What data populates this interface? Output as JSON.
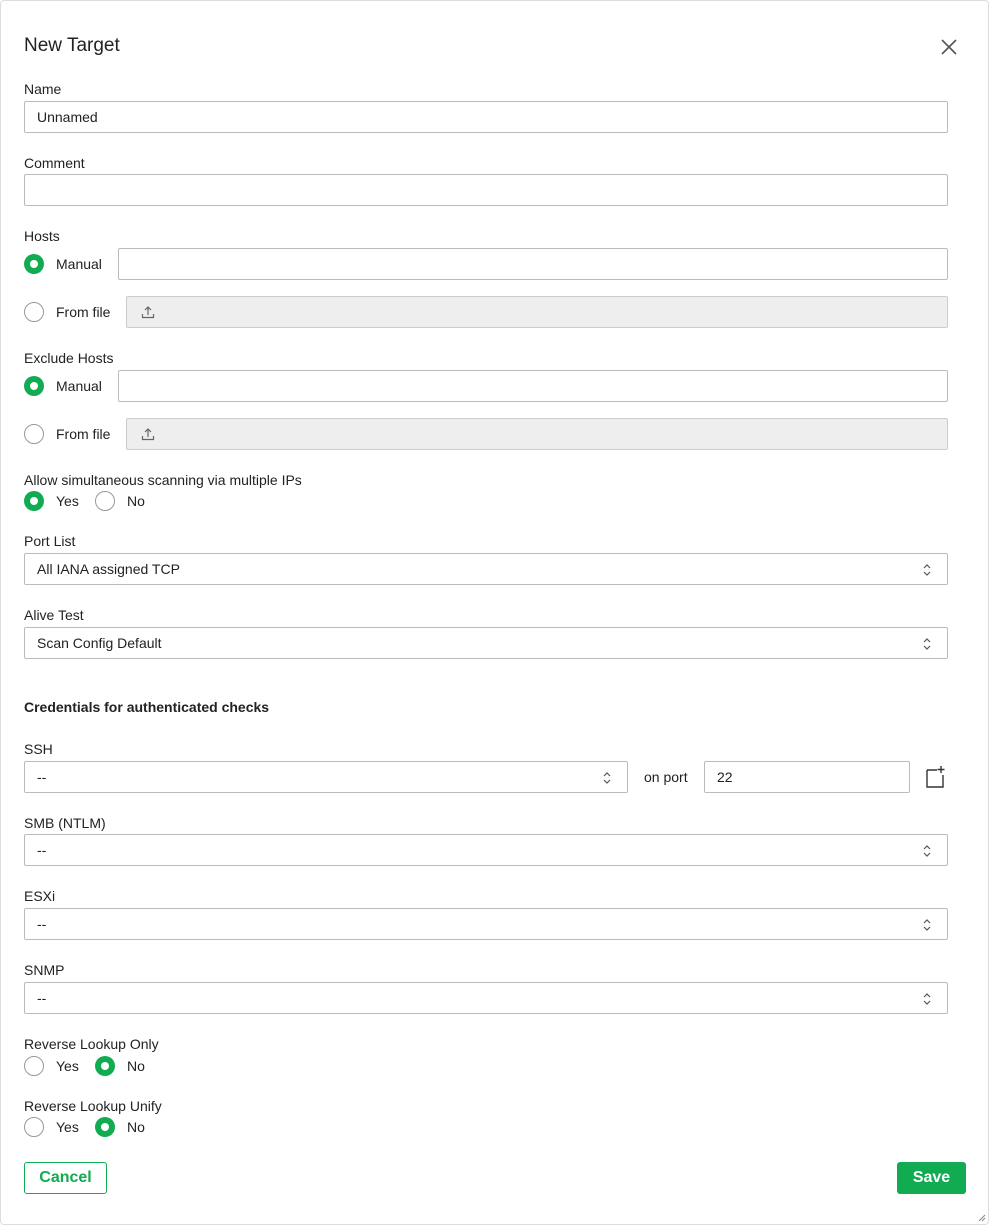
{
  "dialog": {
    "title": "New Target",
    "close_icon": "close-icon"
  },
  "name": {
    "label": "Name",
    "value": "Unnamed"
  },
  "comment": {
    "label": "Comment",
    "value": ""
  },
  "hosts": {
    "label": "Hosts",
    "manual_label": "Manual",
    "manual_value": "",
    "file_label": "From file",
    "selected": "manual"
  },
  "exclude_hosts": {
    "label": "Exclude Hosts",
    "manual_label": "Manual",
    "manual_value": "",
    "file_label": "From file",
    "selected": "manual"
  },
  "simultaneous": {
    "label": "Allow simultaneous scanning via multiple IPs",
    "yes": "Yes",
    "no": "No",
    "selected": "yes"
  },
  "port_list": {
    "label": "Port List",
    "value": "All IANA assigned TCP"
  },
  "alive_test": {
    "label": "Alive Test",
    "value": "Scan Config Default"
  },
  "credentials": {
    "heading": "Credentials for authenticated checks",
    "ssh": {
      "label": "SSH",
      "value": "--",
      "on_port_label": "on port",
      "port": "22"
    },
    "smb": {
      "label": "SMB (NTLM)",
      "value": "--"
    },
    "esxi": {
      "label": "ESXi",
      "value": "--"
    },
    "snmp": {
      "label": "SNMP",
      "value": "--"
    }
  },
  "reverse_lookup_only": {
    "label": "Reverse Lookup Only",
    "yes": "Yes",
    "no": "No",
    "selected": "no"
  },
  "reverse_lookup_unify": {
    "label": "Reverse Lookup Unify",
    "yes": "Yes",
    "no": "No",
    "selected": "no"
  },
  "footer": {
    "cancel": "Cancel",
    "save": "Save"
  },
  "colors": {
    "accent": "#11ab51",
    "border": "#bbbbbb",
    "disabled_bg": "#eeeeee"
  }
}
